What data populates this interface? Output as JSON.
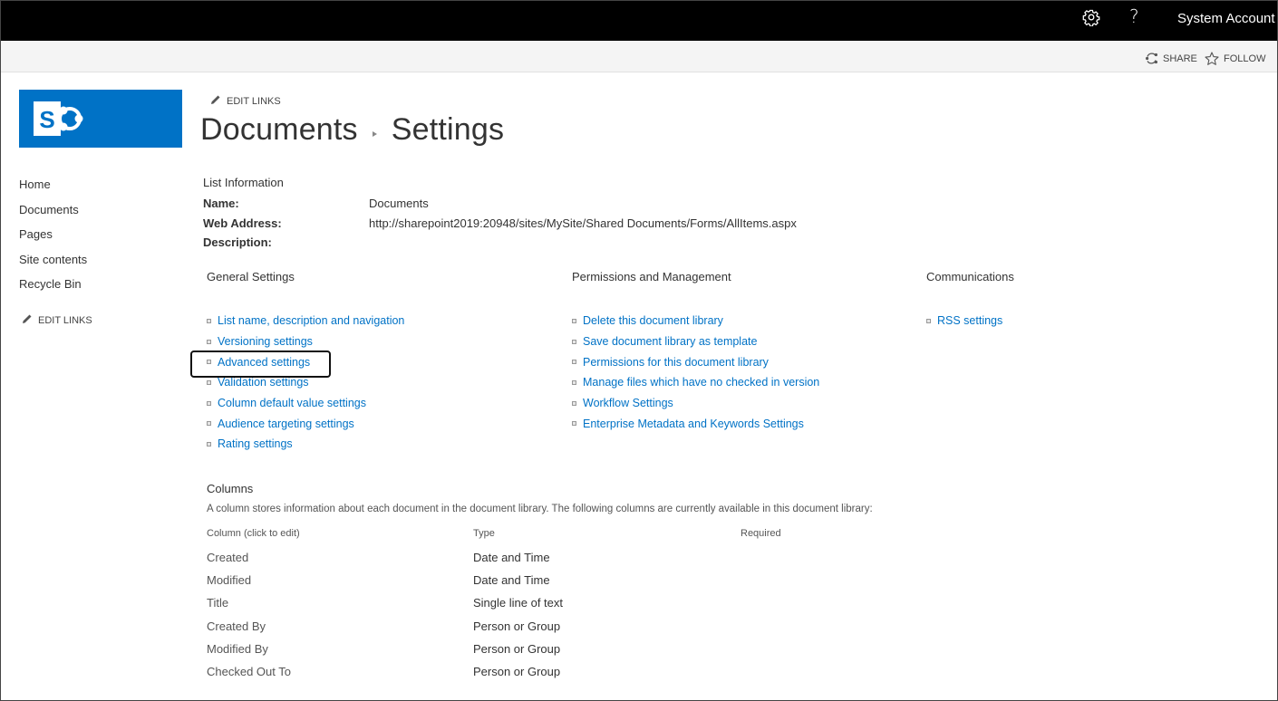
{
  "suitebar": {
    "help_label": "?",
    "account_name": "System Account"
  },
  "ribbon": {
    "share_label": "SHARE",
    "follow_label": "FOLLOW"
  },
  "edit_links_label": "EDIT LINKS",
  "leftnav": {
    "items": [
      {
        "label": "Home"
      },
      {
        "label": "Documents"
      },
      {
        "label": "Pages"
      },
      {
        "label": "Site contents"
      },
      {
        "label": "Recycle Bin"
      }
    ]
  },
  "title": {
    "library": "Documents",
    "page": "Settings"
  },
  "list_info": {
    "heading": "List Information",
    "name_label": "Name:",
    "name_value": "Documents",
    "web_address_label": "Web Address:",
    "web_address_value": "http://sharepoint2019:20948/sites/MySite/Shared Documents/Forms/AllItems.aspx",
    "description_label": "Description:"
  },
  "sections": {
    "general": {
      "title": "General Settings",
      "links": [
        "List name, description and navigation",
        "Versioning settings",
        "Advanced settings",
        "Validation settings",
        "Column default value settings",
        "Audience targeting settings",
        "Rating settings"
      ]
    },
    "permissions": {
      "title": "Permissions and Management",
      "links": [
        "Delete this document library",
        "Save document library as template",
        "Permissions for this document library",
        "Manage files which have no checked in version",
        "Workflow Settings",
        "Enterprise Metadata and Keywords Settings"
      ]
    },
    "communications": {
      "title": "Communications",
      "links": [
        "RSS settings"
      ]
    }
  },
  "columns": {
    "title": "Columns",
    "description": "A column stores information about each document in the document library. The following columns are currently available in this document library:",
    "headers": [
      "Column (click to edit)",
      "Type",
      "Required"
    ],
    "rows": [
      {
        "name": "Created",
        "type": "Date and Time"
      },
      {
        "name": "Modified",
        "type": "Date and Time"
      },
      {
        "name": "Title",
        "type": "Single line of text"
      },
      {
        "name": "Created By",
        "type": "Person or Group"
      },
      {
        "name": "Modified By",
        "type": "Person or Group"
      },
      {
        "name": "Checked Out To",
        "type": "Person or Group"
      }
    ]
  },
  "colors": {
    "link": "#0072c6",
    "brand": "#0072c6",
    "suitebar": "#000000"
  }
}
